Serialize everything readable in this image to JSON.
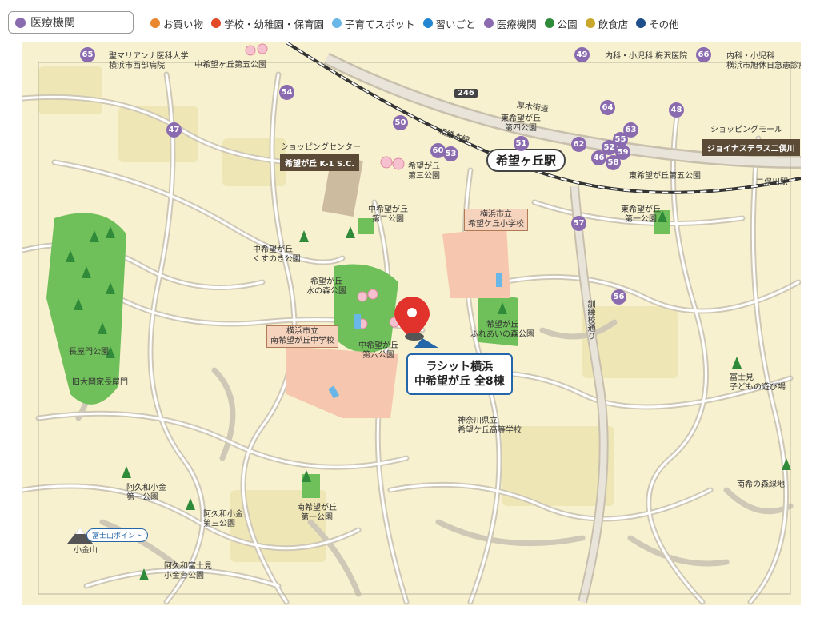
{
  "filter": {
    "label": "医療機関"
  },
  "legend": [
    {
      "label": "お買い物",
      "color": "#e8872e"
    },
    {
      "label": "学校・幼稚園・保育園",
      "color": "#e24a2a"
    },
    {
      "label": "子育てスポット",
      "color": "#69b7e6"
    },
    {
      "label": "習いごと",
      "color": "#2287d0"
    },
    {
      "label": "医療機関",
      "color": "#8b6bb0"
    },
    {
      "label": "公園",
      "color": "#2f8a3a"
    },
    {
      "label": "飲食店",
      "color": "#c8a72a"
    },
    {
      "label": "その他",
      "color": "#1f4f8b"
    }
  ],
  "map": {
    "target": {
      "line1": "ラシット横浜",
      "line2": "中希望が丘 全8棟"
    },
    "station": "希望ヶ丘駅",
    "rail": "相鉄本線",
    "road246": "246",
    "road_atsugi": "厚木街道",
    "road_kunren": "訓練校通り",
    "labels": {
      "marianna": "聖マリアンナ医科大学\n横浜市西部病院",
      "naka5": "中希望ヶ丘第五公園",
      "umezawa": "内科・小児科 梅沢医院",
      "kyujitsu": "内科・小児科\n横浜市旭休日急患診療所",
      "higashi4": "東希望が丘\n第四公園",
      "higashi5": "東希望が丘第五公園",
      "futamatagawa": "二俣川駅",
      "shop_center": "ショッピングセンター",
      "k1sc": "希望が丘 K-1 S.C.",
      "kibo3": "希望が丘\n第三公園",
      "shopping_mall": "ショッピングモール",
      "joinus": "ジョイナステラス二俣川",
      "naka2": "中希望が丘\n第二公園",
      "elementary": "横浜市立\n希望ケ丘小学校",
      "higashi1": "東希望が丘\n第一公園",
      "kusunoki": "中希望が丘\nくすのき公園",
      "mizunomori": "希望が丘\n水の森公園",
      "junior": "横浜市立\n南希望が丘中学校",
      "naka6": "中希望が丘\n第六公園",
      "fureai": "希望が丘\nふれあいの森公園",
      "nagaya_park": "長屋門公園",
      "nagaya_gate": "旧大岡家長屋門",
      "fujimi": "富士見\n子どもの遊び場",
      "kanagawa_high": "神奈川県立\n希望ケ丘高等学校",
      "akuwa1": "阿久和小金\n第一公園",
      "akuwa3": "阿久和小金\n第三公園",
      "minami1": "南希望が丘\n第一公園",
      "minamiki": "南希の森緑地",
      "fuji_point": "富士山ポイント",
      "koganeyama": "小金山",
      "akuwa_fuji": "阿久和富士見\n小金台公園"
    },
    "badges": [
      "65",
      "47",
      "54",
      "50",
      "60",
      "53",
      "51",
      "49",
      "66",
      "64",
      "48",
      "63",
      "55",
      "62",
      "52",
      "59",
      "46",
      "58",
      "57",
      "56"
    ]
  }
}
